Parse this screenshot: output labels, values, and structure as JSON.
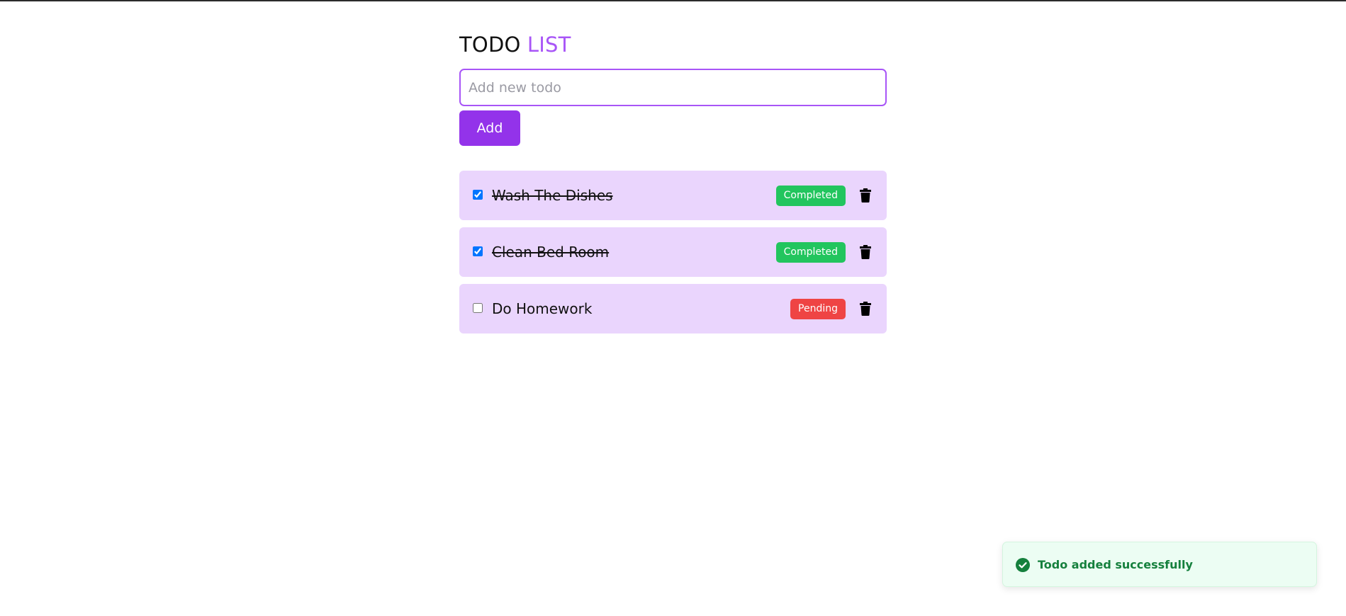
{
  "header": {
    "title_part1": "TODO",
    "title_part2": "LIST"
  },
  "form": {
    "input_placeholder": "Add new todo",
    "input_value": "",
    "add_label": "Add"
  },
  "todos": [
    {
      "text": "Wash The Dishes",
      "checked": true,
      "status": "Completed"
    },
    {
      "text": "Clean Bed Room",
      "checked": true,
      "status": "Completed"
    },
    {
      "text": "Do Homework",
      "checked": false,
      "status": "Pending"
    }
  ],
  "toast": {
    "message": "Todo added successfully",
    "icon": "check-circle-icon"
  },
  "colors": {
    "accent": "#9333ea",
    "accent_light": "#a855f7",
    "item_bg": "#ead5fd",
    "completed": "#22c55e",
    "pending": "#ef4444",
    "toast_bg": "#ecfdf3",
    "toast_text": "#15803d"
  },
  "icons": {
    "delete": "trash-icon"
  }
}
